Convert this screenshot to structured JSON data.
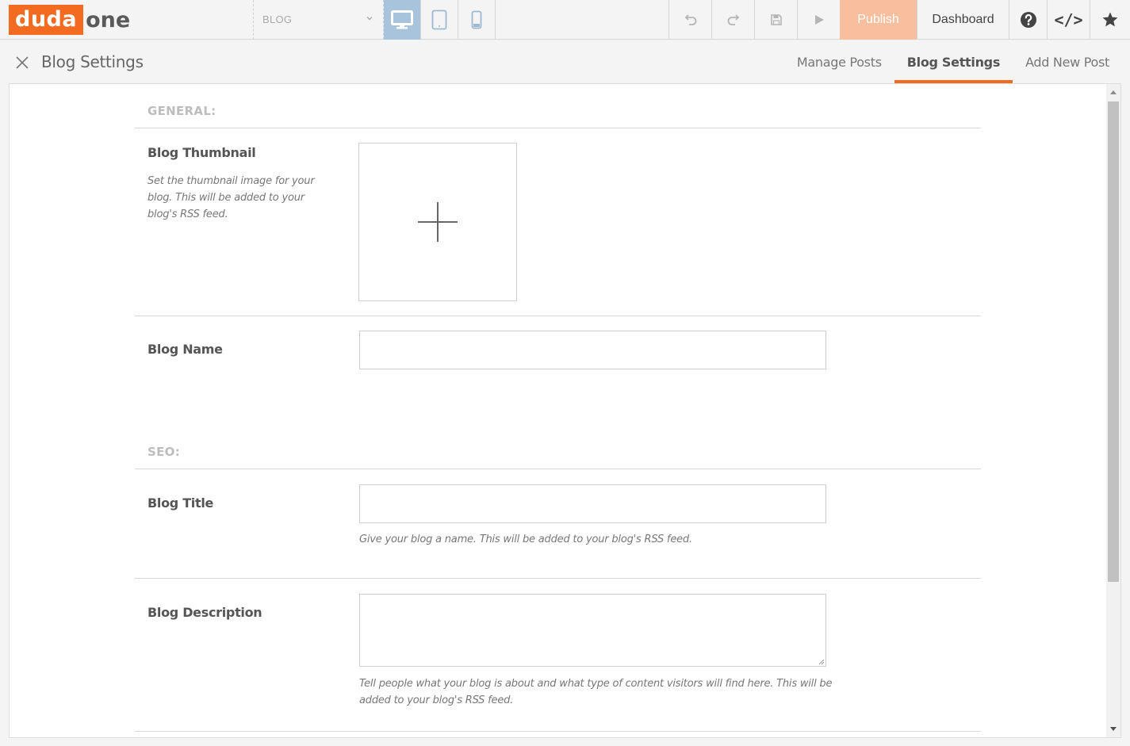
{
  "logo": {
    "brand": "duda",
    "suffix": "one"
  },
  "toolbar": {
    "page_selector": "BLOG",
    "publish_label": "Publish",
    "dashboard_label": "Dashboard",
    "code_label": "</>"
  },
  "subheader": {
    "title": "Blog Settings",
    "tabs": [
      {
        "label": "Manage Posts",
        "active": false
      },
      {
        "label": "Blog Settings",
        "active": true
      },
      {
        "label": "Add New Post",
        "active": false
      }
    ]
  },
  "form": {
    "general_label": "GENERAL:",
    "thumbnail": {
      "label": "Blog Thumbnail",
      "description": "Set the thumbnail image for your blog. This will be added to your blog's RSS feed."
    },
    "blog_name": {
      "label": "Blog Name",
      "value": ""
    },
    "seo_label": "SEO:",
    "blog_title": {
      "label": "Blog Title",
      "value": "",
      "help": "Give your blog a name. This will be added to your blog's RSS feed."
    },
    "blog_description": {
      "label": "Blog Description",
      "value": "",
      "help": "Tell people what your blog is about and what type of content visitors will find here. This will be added to your blog's RSS feed."
    }
  },
  "colors": {
    "accent": "#f26b21",
    "publish_bg": "#f7bf9e",
    "device_active_bg": "#a8c3dc"
  },
  "icons": [
    "monitor-icon",
    "tablet-icon",
    "mobile-icon",
    "undo-icon",
    "redo-icon",
    "save-icon",
    "play-icon",
    "help-icon",
    "code-icon",
    "star-icon",
    "close-icon",
    "plus-icon"
  ]
}
